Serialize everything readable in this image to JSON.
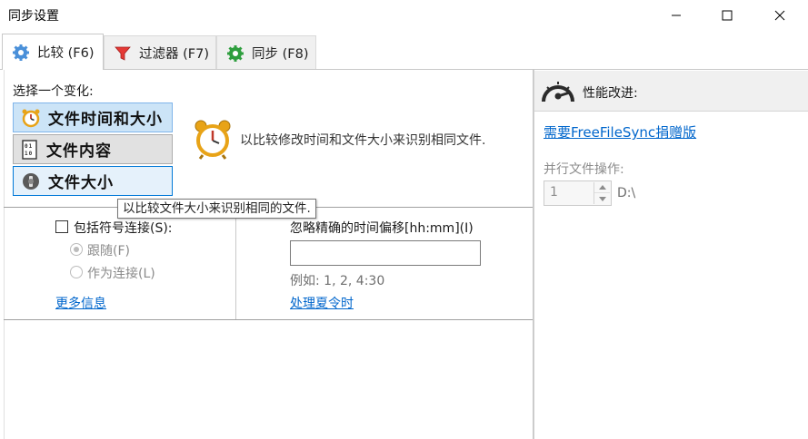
{
  "window": {
    "title": "同步设置",
    "controls": [
      "minimize-icon",
      "maximize-icon",
      "close-icon"
    ]
  },
  "tabs": [
    {
      "label": "比较 (F6)",
      "icon": "gear-icon",
      "active": true
    },
    {
      "label": "过滤器 (F7)",
      "icon": "filter-funnel-icon",
      "active": false
    },
    {
      "label": "同步 (F8)",
      "icon": "sync-gear-icon",
      "active": false
    }
  ],
  "compare": {
    "variant_label": "选择一个变化:",
    "variants": [
      {
        "label": "文件时间和大小",
        "icon": "clock-icon",
        "state": "selected"
      },
      {
        "label": "文件内容",
        "icon": "binary-file-icon",
        "state": "normal"
      },
      {
        "label": "文件大小",
        "icon": "file-size-icon",
        "state": "hover"
      }
    ],
    "description": "以比较修改时间和文件大小来识别相同文件.",
    "tooltip": "以比较文件大小来识别相同的文件.",
    "symlinks": {
      "checkbox_label": "包括符号连接(S):",
      "checked": false,
      "options": [
        {
          "label": "跟随(F)",
          "selected": true
        },
        {
          "label": "作为连接(L)",
          "selected": false
        }
      ]
    },
    "more_info_link": "更多信息",
    "time_shift": {
      "label": "忽略精确的时间偏移[hh:mm](I)",
      "value": "",
      "example": "例如: 1, 2, 4:30",
      "dst_link": "处理夏令时"
    }
  },
  "performance": {
    "title": "性能改进:",
    "icon": "speedometer-icon",
    "donation_link": "需要FreeFileSync捐赠版",
    "parallel_label": "并行文件操作:",
    "parallel_value": "1",
    "drive": "D:\\"
  },
  "colors": {
    "selected_bg": "#cce4f7",
    "hover_border": "#0078d7",
    "link": "#0066cc",
    "filter_icon": "#e53935",
    "sync_icon": "#2e9e3e"
  }
}
